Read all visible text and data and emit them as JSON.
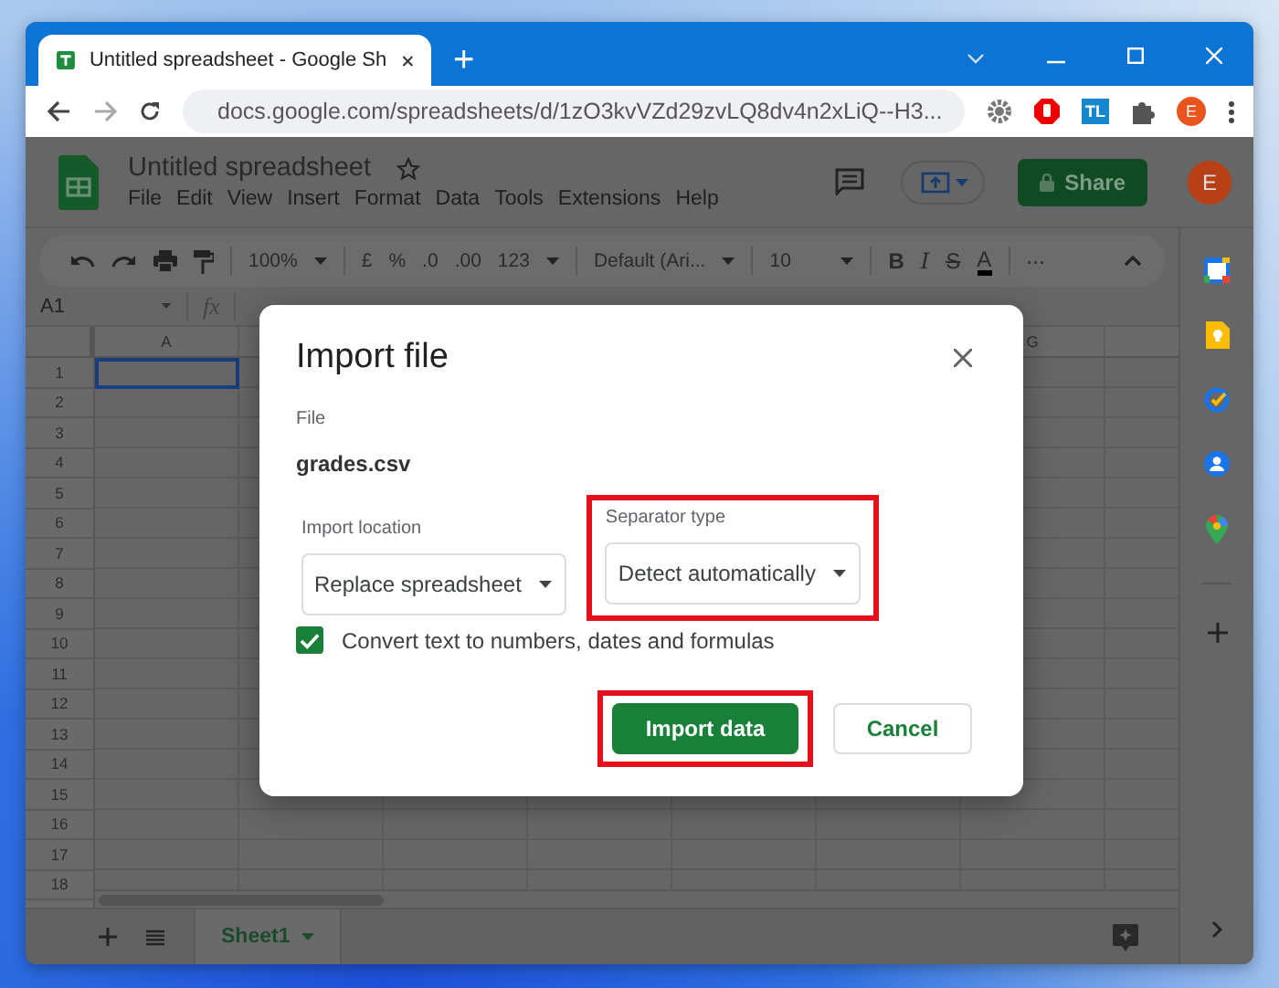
{
  "browser": {
    "tab_title": "Untitled spreadsheet - Google Sh",
    "new_tab": "+",
    "address": "docs.google.com/spreadsheets/d/1zO3kvVZd29zvLQ8dv4n2xLiQ--H3...",
    "extension_badge": "TL",
    "profile_initial": "E"
  },
  "app": {
    "title": "Untitled spreadsheet",
    "menus": [
      "File",
      "Edit",
      "View",
      "Insert",
      "Format",
      "Data",
      "Tools",
      "Extensions",
      "Help"
    ],
    "share": "Share",
    "avatar": "E"
  },
  "toolbar": {
    "zoom": "100%",
    "formats": [
      "£",
      "%",
      ".0",
      ".00",
      "123"
    ],
    "font": "Default (Ari...",
    "font_size": "10",
    "styles": [
      {
        "kind": "bold",
        "label": "B"
      },
      {
        "kind": "italic",
        "label": "I"
      },
      {
        "kind": "strike",
        "label": "S"
      },
      {
        "kind": "color",
        "label": "A"
      }
    ],
    "more": "⋯"
  },
  "formula_bar": {
    "cell": "A1",
    "fx": "fx"
  },
  "grid": {
    "columns": [
      "A",
      "G"
    ],
    "rows": [
      "1",
      "2",
      "3",
      "4",
      "5",
      "6",
      "7",
      "8",
      "9",
      "10",
      "11",
      "12",
      "13",
      "14",
      "15",
      "16",
      "17",
      "18"
    ]
  },
  "sheets": [
    {
      "name": "Sheet1",
      "selected": true
    }
  ],
  "dialog": {
    "title": "Import file",
    "file_label": "File",
    "file_name": "grades.csv",
    "fields": [
      {
        "label": "Import location",
        "value": "Replace spreadsheet",
        "highlighted": false
      },
      {
        "label": "Separator type",
        "value": "Detect automatically",
        "highlighted": true
      }
    ],
    "checkbox": {
      "label": "Convert text to numbers, dates and formulas",
      "checked": true
    },
    "buttons": [
      {
        "kind": "primary",
        "label": "Import data",
        "highlighted": true
      },
      {
        "kind": "secondary",
        "label": "Cancel",
        "highlighted": false
      }
    ]
  }
}
